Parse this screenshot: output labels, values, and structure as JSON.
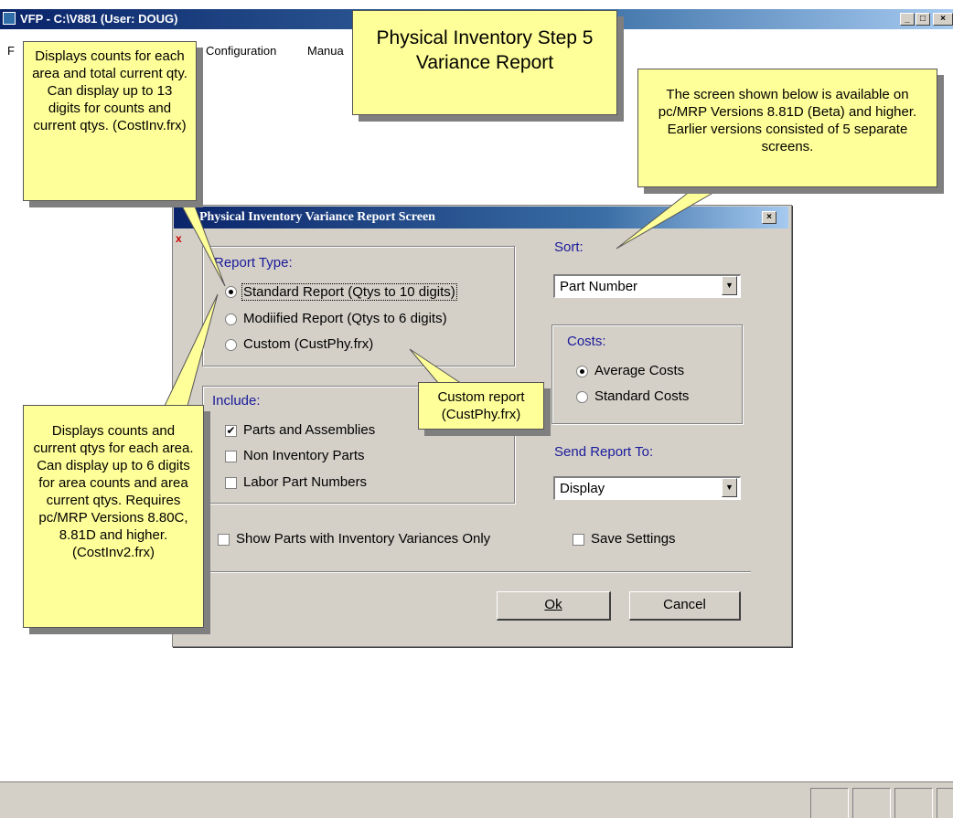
{
  "window": {
    "title": "VFP - C:\\V881  (User: DOUG)",
    "minimize_label": "_",
    "maximize_label": "□",
    "close_label": "×"
  },
  "menu": [
    "F",
    "Configuration",
    "Manua"
  ],
  "dialog": {
    "title": "Physical Inventory Variance Report Screen",
    "close_label": "×",
    "x_mark": "x",
    "report_type": {
      "label": "Report Type:",
      "options": [
        {
          "label": "Standard Report (Qtys to 10 digits)",
          "selected": true
        },
        {
          "label": "Modiified Report (Qtys to 6 digits)",
          "selected": false
        },
        {
          "label": "Custom (CustPhy.frx)",
          "selected": false
        }
      ]
    },
    "include": {
      "label": "Include:",
      "options": [
        {
          "label": "Parts and Assemblies",
          "checked": true
        },
        {
          "label": "Non Inventory Parts",
          "checked": false
        },
        {
          "label": "Labor Part Numbers",
          "checked": false
        }
      ]
    },
    "sort": {
      "label": "Sort:",
      "value": "Part Number"
    },
    "costs": {
      "label": "Costs:",
      "options": [
        {
          "label": "Average Costs",
          "selected": true
        },
        {
          "label": "Standard Costs",
          "selected": false
        }
      ]
    },
    "send_to": {
      "label": "Send Report To:",
      "value": "Display"
    },
    "show_variances_only": {
      "label": "Show Parts with Inventory Variances Only",
      "checked": false
    },
    "save_settings": {
      "label": "Save Settings",
      "checked": false
    },
    "ok_label": "Ok",
    "cancel_label": "Cancel"
  },
  "callouts": {
    "title": "Physical Inventory Step 5 Variance Report",
    "top_left": "Displays counts for each area and total current qty.  Can display up to 13 digits for counts and current qtys. (CostInv.frx)",
    "top_right": "The screen shown below is available on pc/MRP Versions 8.81D (Beta) and higher.  Earlier versions consisted of 5 separate screens.",
    "bottom_left": "Displays counts and current qtys for each area.  Can display up to 6 digits for area counts and area current qtys. Requires pc/MRP Versions 8.80C, 8.81D and higher.  (CostInv2.frx)",
    "custom": "Custom report (CustPhy.frx)"
  },
  "colors": {
    "callout_fill": "#ffff99",
    "title_bar": "#0a246a",
    "dialog_face": "#d4d0c8",
    "label_blue": "#1a1a9a"
  },
  "icons": [
    "app-icon",
    "minimize-icon",
    "maximize-icon",
    "close-icon",
    "dropdown-arrow-icon"
  ]
}
